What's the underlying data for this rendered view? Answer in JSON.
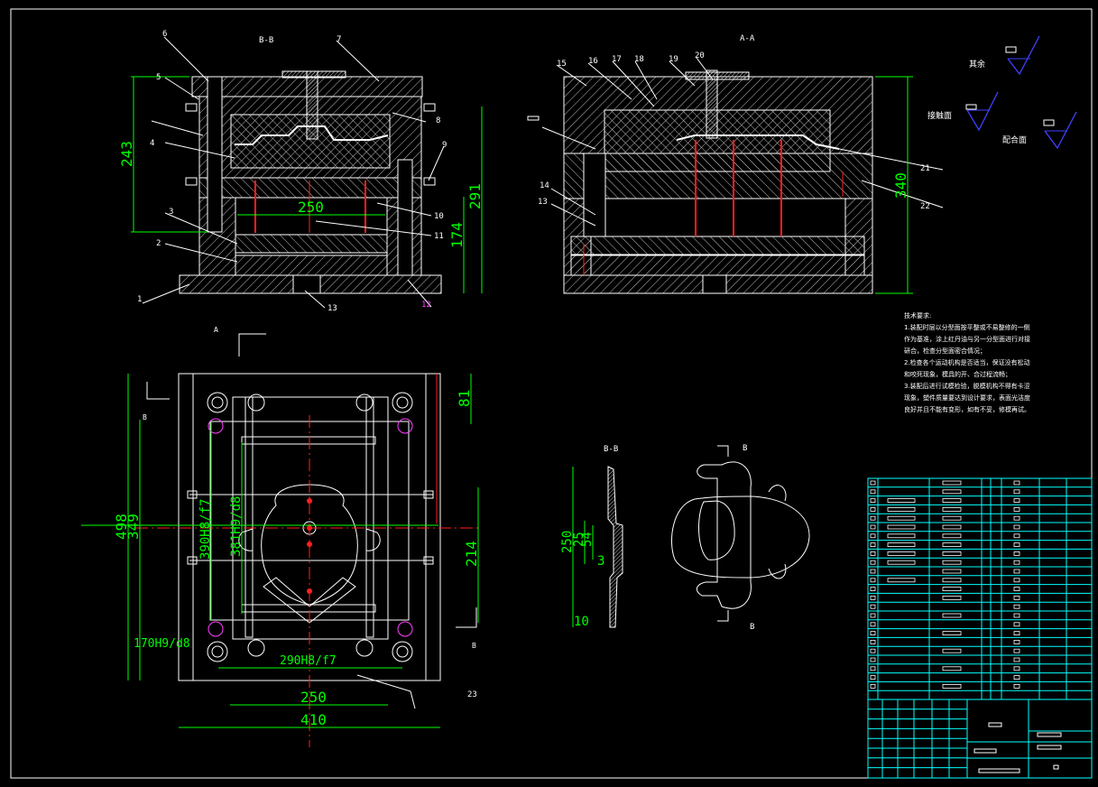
{
  "section_labels": {
    "bb_top": "B-B",
    "aa_top": "A-A",
    "bb_part": "B-B",
    "b_top_right": "B",
    "b_bottom_right": "B",
    "a_plan": "A",
    "b_plan_left": "B",
    "b_plan_right": "B"
  },
  "callouts_left": [
    "1",
    "2",
    "3",
    "4",
    "5",
    "6",
    "7",
    "8",
    "9",
    "10",
    "11",
    "12",
    "13"
  ],
  "callouts_right": [
    "13",
    "14",
    "15",
    "16",
    "17",
    "18",
    "19",
    "20",
    "21",
    "22"
  ],
  "callout_plan": "23",
  "dims": {
    "d243": "243",
    "d291": "291",
    "d174": "174",
    "d250_sec": "250",
    "d340": "340",
    "d81": "81",
    "d498": "498",
    "d349": "349",
    "d214": "214",
    "fit_390": "390H8/f7",
    "fit_381": "381H9/d8",
    "fit_170": "170H9/d8",
    "fit_290": "290H8/f7",
    "d250_plan": "250",
    "d410": "410",
    "p250": "250",
    "p25": "25",
    "p54": "54",
    "p3": "3",
    "p10": "10"
  },
  "roughness": {
    "rest": "其余",
    "contact": "接触面",
    "fit": "配合面"
  },
  "tech_notes": {
    "title": "技术要求:",
    "items": [
      "1.装配时层以分型面按平整或不易整修的一侧作为基准，涂上红丹油与另一分型面进行对接研合，检查分型面密合情况；",
      "2.检查各个运动机构是否适当，保证没有松动和咬死现象，模具的开、合过程流畅；",
      "3.装配后进行试模检验，脱模机构不得有卡涩现象，塑件质量要达到设计要求，表面光洁度良好并且不能有变形，如有不妥，修模再试。"
    ]
  },
  "colors": {
    "line": "#ffffff",
    "dim": "#00ff00",
    "center": "#ff2020",
    "magenta": "#ff40ff",
    "cyan": "#00ffff",
    "blue": "#4040ff",
    "hatch": "#cfcfcf"
  }
}
